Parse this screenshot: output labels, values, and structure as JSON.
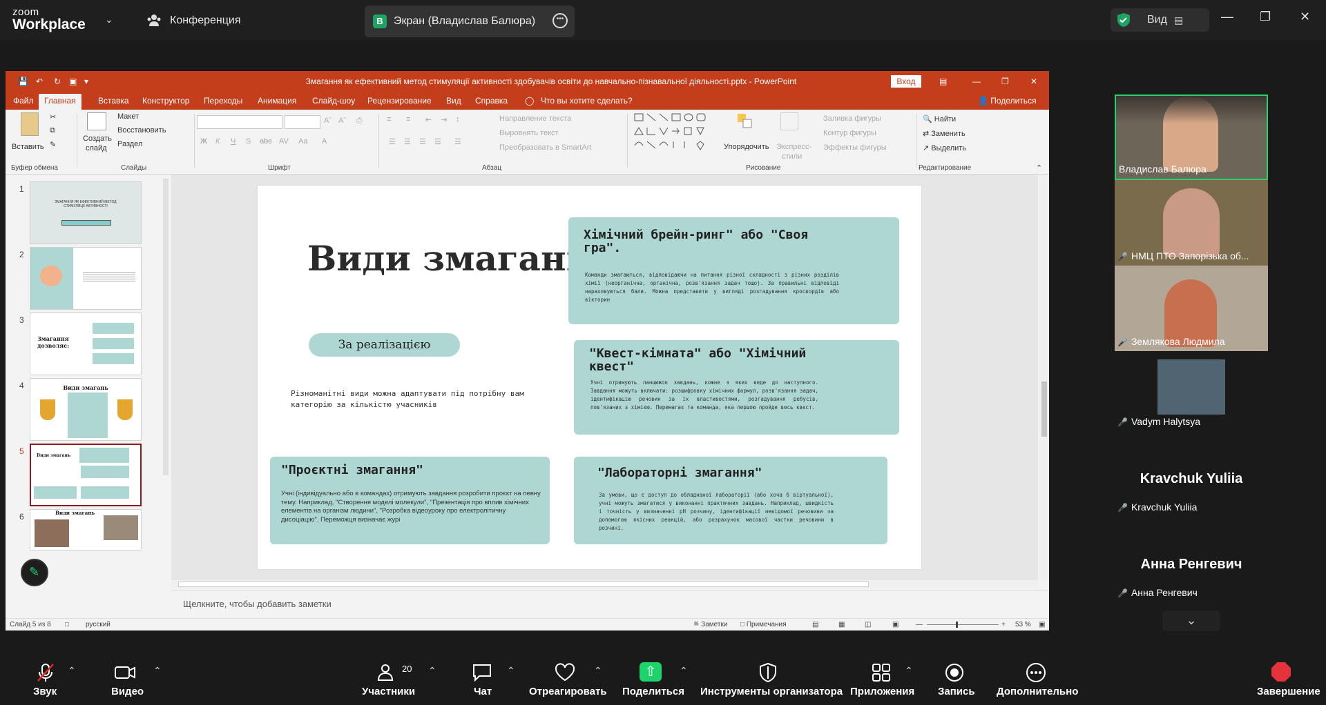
{
  "zoom": {
    "logo_line1": "zoom",
    "logo_line2": "Workplace",
    "conference_label": "Конференция",
    "screen_tab": {
      "avatar": "В",
      "label": "Экран (Владислав Балюра)"
    },
    "view_label": "Вид",
    "shield_color": "#1fa362"
  },
  "ppt": {
    "title": "Змагання як ефективний метод стимуляції активності здобувачів освіти до навчально-пізнавальної діяльності.pptx  -  PowerPoint",
    "vhod": "Вход",
    "tabs": [
      "Файл",
      "Главная",
      "Вставка",
      "Конструктор",
      "Переходы",
      "Анимация",
      "Слайд-шоу",
      "Рецензирование",
      "Вид",
      "Справка"
    ],
    "tellme": "Что вы хотите сделать?",
    "share": "Поделиться",
    "ribbon": {
      "paste": "Вставить",
      "new_slide_1": "Создать",
      "new_slide_2": "слайд",
      "layout": "Макет",
      "reset": "Восстановить",
      "section": "Раздел",
      "text_direction": "Направление текста",
      "align_text": "Выровнять текст",
      "smartart": "Преобразовать в SmartArt",
      "arrange": "Упорядочить",
      "express_1": "Экспресс-",
      "express_2": "стили",
      "fill": "Заливка фигуры",
      "outline": "Контур фигуры",
      "effects": "Эффекты фигуры",
      "find": "Найти",
      "replace": "Заменить",
      "select": "Выделить",
      "groups": {
        "clipboard": "Буфер обмена",
        "slides": "Слайды",
        "font": "Шрифт",
        "paragraph": "Абзац",
        "drawing": "Рисование",
        "editing": "Редактирование"
      }
    },
    "thumbs": [
      {
        "num": "1",
        "text": "ЗМАГАННЯ ЯК ЕФЕКТИВНИЙ МЕТОД СТИМУЛЯЦІЇ АКТИВНОСТІ"
      },
      {
        "num": "2",
        "text": ""
      },
      {
        "num": "3",
        "text": "Змагання дозволяє:"
      },
      {
        "num": "4",
        "text": "Види змагань"
      },
      {
        "num": "5",
        "text": "Види змагань"
      },
      {
        "num": "6",
        "text": "Види змагань"
      }
    ],
    "notes_placeholder": "Щелкните, чтобы добавить заметки",
    "status": {
      "slide": "Слайд 5 из 8",
      "language": "русский",
      "notes": "Заметки",
      "comments": "Примечания",
      "zoom": "53 %"
    }
  },
  "slide": {
    "title": "Види змагань",
    "pill": "За реалізацією",
    "subtitle": "Різноманітні види можна адаптувати під потрібну вам категорію за кількістю учасників",
    "cards": [
      {
        "title": "Хімічний брейн-ринг\" або \"Своя гра\".",
        "body": "Команди змагаються, відповідаючи на питання різної складності з різних розділів хімії (неорганічна, органічна, розв'язання задач тощо). За правильні відповіді нараховуються бали. Можна представити у вигляді розгадування кросвордів або вікторин"
      },
      {
        "title": "\"Квест-кімната\" або \"Хімічний квест\"",
        "body": "Учні отримують ланцюжок завдань, кожне з яких веде до наступного. Завдання можуть включати: розшифровку хімічних формул, розв'язання задач, ідентифікацію речовин за їх властивостями, розгадування ребусів, пов'язаних з хімією. Перемагає та команда, яка першою пройде весь квест."
      },
      {
        "title": "\"Проєктні змагання\"",
        "body": "Учні (індивідуально або в командах) отримують завдання розробити проєкт на певну тему. Наприклад, \"Створення моделі молекули\", \"Презентація про вплив хімічних елементів на організм людини\", \"Розробка відеоуроку про електролітичну дисоціацію\". Переможця визначає журі"
      },
      {
        "title": "\"Лабораторні змагання\"",
        "body": "За умови, що є доступ до обладнаної лабораторії (або хоча б віртуальної), учні можуть змагатися у виконанні практичних завдань. Наприклад, швидкість і точність у визначенні pH розчину, ідентифікації невідомої речовини за допомогою якісних реакцій, або розрахунок масової частки речовини в розчині."
      }
    ],
    "card_color": "#aed7d3"
  },
  "participants": [
    {
      "name": "Владислав Балюра",
      "muted": false
    },
    {
      "name": "НМЦ ПТО Запорізька об...",
      "muted": true
    },
    {
      "name": "Землякова Людмила",
      "muted": true
    },
    {
      "name": "Vadym Halytsya",
      "muted": true
    },
    {
      "name": "Kravchuk Yuliia",
      "big": "Kravchuk Yuliia",
      "muted": true
    },
    {
      "name": "Анна Ренгевич",
      "big": "Анна Ренгевич",
      "muted": true
    }
  ],
  "bottom": {
    "audio": "Звук",
    "video": "Видео",
    "participants": "Участники",
    "participants_count": "20",
    "chat": "Чат",
    "react": "Отреагировать",
    "share": "Поделиться",
    "host_tools": "Инструменты организатора",
    "apps": "Приложения",
    "record": "Запись",
    "more": "Дополнительно",
    "end": "Завершение"
  }
}
